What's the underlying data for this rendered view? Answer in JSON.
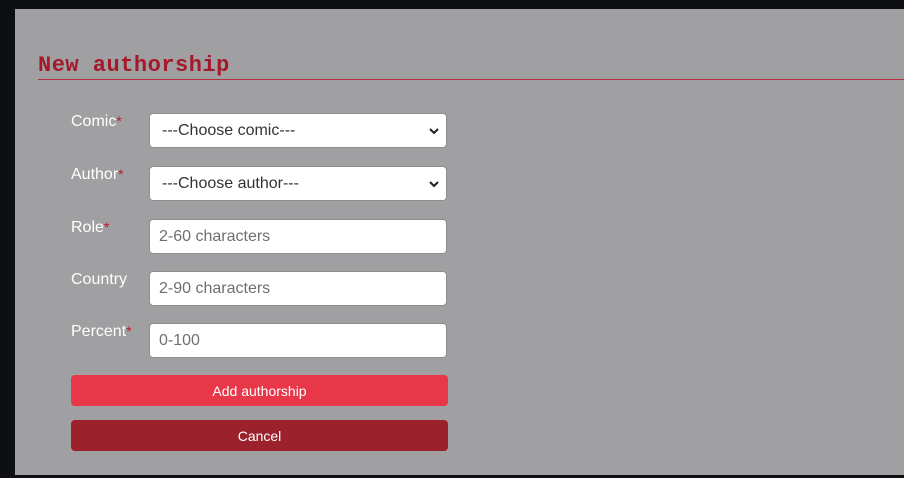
{
  "page": {
    "title": "New authorship"
  },
  "form": {
    "comic": {
      "label": "Comic",
      "required_mark": "*",
      "selected": "---Choose comic---"
    },
    "author": {
      "label": "Author",
      "required_mark": "*",
      "selected": "---Choose author---"
    },
    "role": {
      "label": "Role",
      "required_mark": "*",
      "placeholder": "2-60 characters",
      "value": ""
    },
    "country": {
      "label": "Country",
      "placeholder": "2-90 characters",
      "value": ""
    },
    "percent": {
      "label": "Percent",
      "required_mark": "*",
      "placeholder": "0-100",
      "value": ""
    }
  },
  "buttons": {
    "add_label": "Add authorship",
    "cancel_label": "Cancel"
  },
  "colors": {
    "accent": "#a3192a",
    "add_button": "#e73749",
    "cancel_button": "#9b222c",
    "panel_bg": "#a09fa1"
  },
  "icons": {
    "select_chevron": "chevron-down-icon"
  }
}
